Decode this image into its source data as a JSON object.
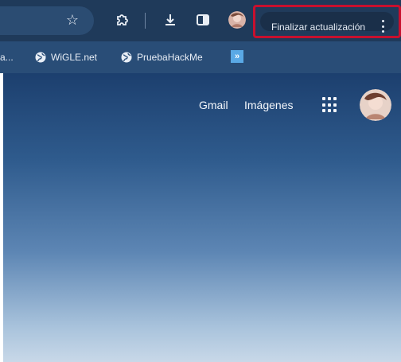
{
  "toolbar": {
    "star_icon": "star-icon",
    "extensions_icon": "puzzle-icon",
    "download_icon": "download-icon",
    "side_panel_icon": "side-panel-icon",
    "profile_icon": "avatar",
    "update_button_label": "Finalizar actualización",
    "menu_icon": "kebab-menu-icon"
  },
  "bookmarks": {
    "items": [
      {
        "label": "a..."
      },
      {
        "label": "WiGLE.net",
        "icon": "globe-icon"
      },
      {
        "label": "PruebaHackMe",
        "icon": "globe-icon"
      }
    ],
    "overflow_icon": "chevron-double-right-icon"
  },
  "page": {
    "links": [
      {
        "label": "Gmail"
      },
      {
        "label": "Imágenes"
      }
    ],
    "apps_icon": "apps-grid-icon",
    "avatar_icon": "avatar"
  },
  "colors": {
    "toolbar_bg": "#1f3a5a",
    "bookmarks_bg": "#294d77",
    "highlight_border": "#c8102e",
    "page_gradient_top": "#1c3f6e",
    "page_gradient_bottom": "#c8d8e8"
  }
}
